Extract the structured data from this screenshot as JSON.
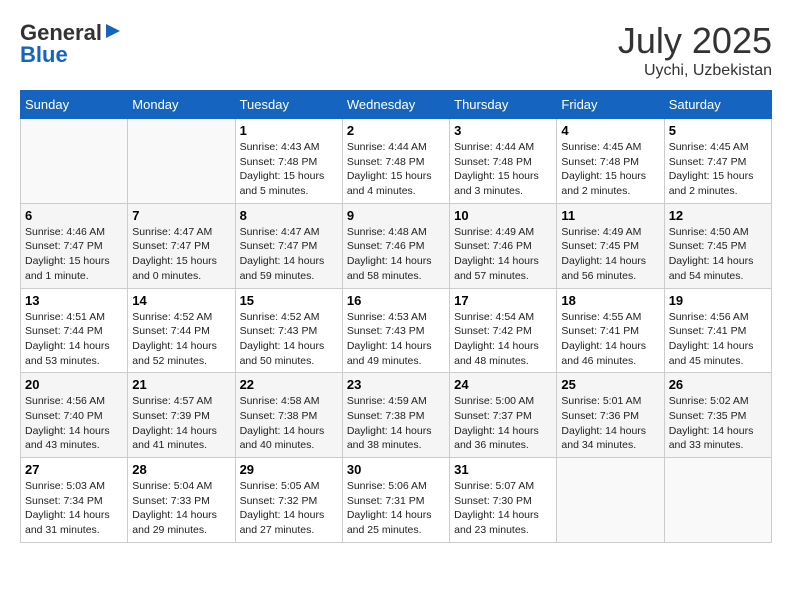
{
  "header": {
    "logo_general": "General",
    "logo_blue": "Blue",
    "month": "July 2025",
    "location": "Uychi, Uzbekistan"
  },
  "weekdays": [
    "Sunday",
    "Monday",
    "Tuesday",
    "Wednesday",
    "Thursday",
    "Friday",
    "Saturday"
  ],
  "weeks": [
    [
      {
        "day": "",
        "info": ""
      },
      {
        "day": "",
        "info": ""
      },
      {
        "day": "1",
        "info": "Sunrise: 4:43 AM\nSunset: 7:48 PM\nDaylight: 15 hours\nand 5 minutes."
      },
      {
        "day": "2",
        "info": "Sunrise: 4:44 AM\nSunset: 7:48 PM\nDaylight: 15 hours\nand 4 minutes."
      },
      {
        "day": "3",
        "info": "Sunrise: 4:44 AM\nSunset: 7:48 PM\nDaylight: 15 hours\nand 3 minutes."
      },
      {
        "day": "4",
        "info": "Sunrise: 4:45 AM\nSunset: 7:48 PM\nDaylight: 15 hours\nand 2 minutes."
      },
      {
        "day": "5",
        "info": "Sunrise: 4:45 AM\nSunset: 7:47 PM\nDaylight: 15 hours\nand 2 minutes."
      }
    ],
    [
      {
        "day": "6",
        "info": "Sunrise: 4:46 AM\nSunset: 7:47 PM\nDaylight: 15 hours\nand 1 minute."
      },
      {
        "day": "7",
        "info": "Sunrise: 4:47 AM\nSunset: 7:47 PM\nDaylight: 15 hours\nand 0 minutes."
      },
      {
        "day": "8",
        "info": "Sunrise: 4:47 AM\nSunset: 7:47 PM\nDaylight: 14 hours\nand 59 minutes."
      },
      {
        "day": "9",
        "info": "Sunrise: 4:48 AM\nSunset: 7:46 PM\nDaylight: 14 hours\nand 58 minutes."
      },
      {
        "day": "10",
        "info": "Sunrise: 4:49 AM\nSunset: 7:46 PM\nDaylight: 14 hours\nand 57 minutes."
      },
      {
        "day": "11",
        "info": "Sunrise: 4:49 AM\nSunset: 7:45 PM\nDaylight: 14 hours\nand 56 minutes."
      },
      {
        "day": "12",
        "info": "Sunrise: 4:50 AM\nSunset: 7:45 PM\nDaylight: 14 hours\nand 54 minutes."
      }
    ],
    [
      {
        "day": "13",
        "info": "Sunrise: 4:51 AM\nSunset: 7:44 PM\nDaylight: 14 hours\nand 53 minutes."
      },
      {
        "day": "14",
        "info": "Sunrise: 4:52 AM\nSunset: 7:44 PM\nDaylight: 14 hours\nand 52 minutes."
      },
      {
        "day": "15",
        "info": "Sunrise: 4:52 AM\nSunset: 7:43 PM\nDaylight: 14 hours\nand 50 minutes."
      },
      {
        "day": "16",
        "info": "Sunrise: 4:53 AM\nSunset: 7:43 PM\nDaylight: 14 hours\nand 49 minutes."
      },
      {
        "day": "17",
        "info": "Sunrise: 4:54 AM\nSunset: 7:42 PM\nDaylight: 14 hours\nand 48 minutes."
      },
      {
        "day": "18",
        "info": "Sunrise: 4:55 AM\nSunset: 7:41 PM\nDaylight: 14 hours\nand 46 minutes."
      },
      {
        "day": "19",
        "info": "Sunrise: 4:56 AM\nSunset: 7:41 PM\nDaylight: 14 hours\nand 45 minutes."
      }
    ],
    [
      {
        "day": "20",
        "info": "Sunrise: 4:56 AM\nSunset: 7:40 PM\nDaylight: 14 hours\nand 43 minutes."
      },
      {
        "day": "21",
        "info": "Sunrise: 4:57 AM\nSunset: 7:39 PM\nDaylight: 14 hours\nand 41 minutes."
      },
      {
        "day": "22",
        "info": "Sunrise: 4:58 AM\nSunset: 7:38 PM\nDaylight: 14 hours\nand 40 minutes."
      },
      {
        "day": "23",
        "info": "Sunrise: 4:59 AM\nSunset: 7:38 PM\nDaylight: 14 hours\nand 38 minutes."
      },
      {
        "day": "24",
        "info": "Sunrise: 5:00 AM\nSunset: 7:37 PM\nDaylight: 14 hours\nand 36 minutes."
      },
      {
        "day": "25",
        "info": "Sunrise: 5:01 AM\nSunset: 7:36 PM\nDaylight: 14 hours\nand 34 minutes."
      },
      {
        "day": "26",
        "info": "Sunrise: 5:02 AM\nSunset: 7:35 PM\nDaylight: 14 hours\nand 33 minutes."
      }
    ],
    [
      {
        "day": "27",
        "info": "Sunrise: 5:03 AM\nSunset: 7:34 PM\nDaylight: 14 hours\nand 31 minutes."
      },
      {
        "day": "28",
        "info": "Sunrise: 5:04 AM\nSunset: 7:33 PM\nDaylight: 14 hours\nand 29 minutes."
      },
      {
        "day": "29",
        "info": "Sunrise: 5:05 AM\nSunset: 7:32 PM\nDaylight: 14 hours\nand 27 minutes."
      },
      {
        "day": "30",
        "info": "Sunrise: 5:06 AM\nSunset: 7:31 PM\nDaylight: 14 hours\nand 25 minutes."
      },
      {
        "day": "31",
        "info": "Sunrise: 5:07 AM\nSunset: 7:30 PM\nDaylight: 14 hours\nand 23 minutes."
      },
      {
        "day": "",
        "info": ""
      },
      {
        "day": "",
        "info": ""
      }
    ]
  ]
}
